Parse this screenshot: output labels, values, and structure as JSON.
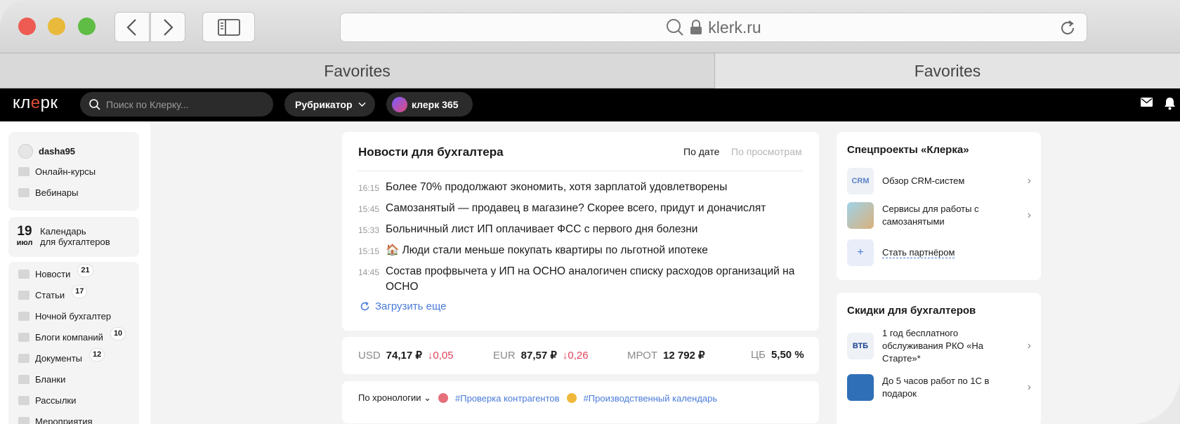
{
  "browser": {
    "url": "klerk.ru",
    "favorites": [
      "Favorites",
      "Favorites"
    ]
  },
  "header": {
    "logo": "кл",
    "logo_mid": "е",
    "logo_end": "рк",
    "search_placeholder": "Поиск по Клерку...",
    "rubricator": "Рубрикатор",
    "klerk365": "клерк 365"
  },
  "sidebar": {
    "username": "dasha95",
    "top_items": [
      {
        "label": "Онлайн-курсы",
        "icon": "video-icon"
      },
      {
        "label": "Вебинары",
        "icon": "monitor-icon"
      }
    ],
    "calendar": {
      "day": "19",
      "month": "июл",
      "line1": "Календарь",
      "line2": "для бухгалтеров"
    },
    "nav_items": [
      {
        "label": "Новости",
        "count": "21",
        "icon": "news-icon"
      },
      {
        "label": "Статьи",
        "count": "17",
        "icon": "article-icon"
      },
      {
        "label": "Ночной бухгалтер",
        "count": "",
        "icon": "moon-icon"
      },
      {
        "label": "Блоги компаний",
        "count": "10",
        "icon": "pencil-icon"
      },
      {
        "label": "Документы",
        "count": "12",
        "icon": "folder-icon"
      },
      {
        "label": "Бланки",
        "count": "",
        "icon": "form-icon"
      },
      {
        "label": "Рассылки",
        "count": "",
        "icon": "mail-icon"
      },
      {
        "label": "Мероприятия",
        "count": "",
        "icon": "event-icon"
      }
    ]
  },
  "news": {
    "title": "Новости для бухгалтера",
    "sort_by_date": "По дате",
    "sort_by_views": "По просмотрам",
    "items": [
      {
        "time": "16:15",
        "title": "Более 70% продолжают экономить, хотя зарплатой удовлетворены"
      },
      {
        "time": "15:45",
        "title": "Самозанятый — продавец в магазине? Скорее всего, придут и доначислят"
      },
      {
        "time": "15:33",
        "title": "Больничный лист ИП оплачивает ФСС с первого дня болезни"
      },
      {
        "time": "15:15",
        "title": "🏠 Люди стали меньше покупать квартиры по льготной ипотеке"
      },
      {
        "time": "14:45",
        "title": "Состав профвычета у ИП на ОСНО аналогичен списку расходов организаций на ОСНО"
      }
    ],
    "load_more": "Загрузить еще"
  },
  "rates": {
    "usd": {
      "label": "USD",
      "value": "74,17 ₽",
      "change": "↓0,05"
    },
    "eur": {
      "label": "EUR",
      "value": "87,57 ₽",
      "change": "↓0,26"
    },
    "mrot": {
      "label": "МРОТ",
      "value": "12 792 ₽"
    },
    "cb": {
      "label": "ЦБ",
      "value": "5,50 %"
    }
  },
  "feed": {
    "sort": "По хронологии",
    "tags": [
      "#Проверка контрагентов",
      "#Производственный календарь"
    ]
  },
  "special": {
    "title": "Спецпроекты «Клерка»",
    "items": [
      {
        "label": "Обзор CRM-систем",
        "thumb": "CRM"
      },
      {
        "label": "Сервисы для работы с самозанятыми",
        "thumb": ""
      },
      {
        "label": "Стать партнёром",
        "thumb": "+"
      }
    ]
  },
  "discounts": {
    "title": "Скидки для бухгалтеров",
    "items": [
      {
        "label": "1 год бесплатного обслуживания РКО «На Старте»*",
        "thumb": "ВТБ"
      },
      {
        "label": "До 5 часов работ по 1С в подарок",
        "thumb": ""
      }
    ]
  }
}
